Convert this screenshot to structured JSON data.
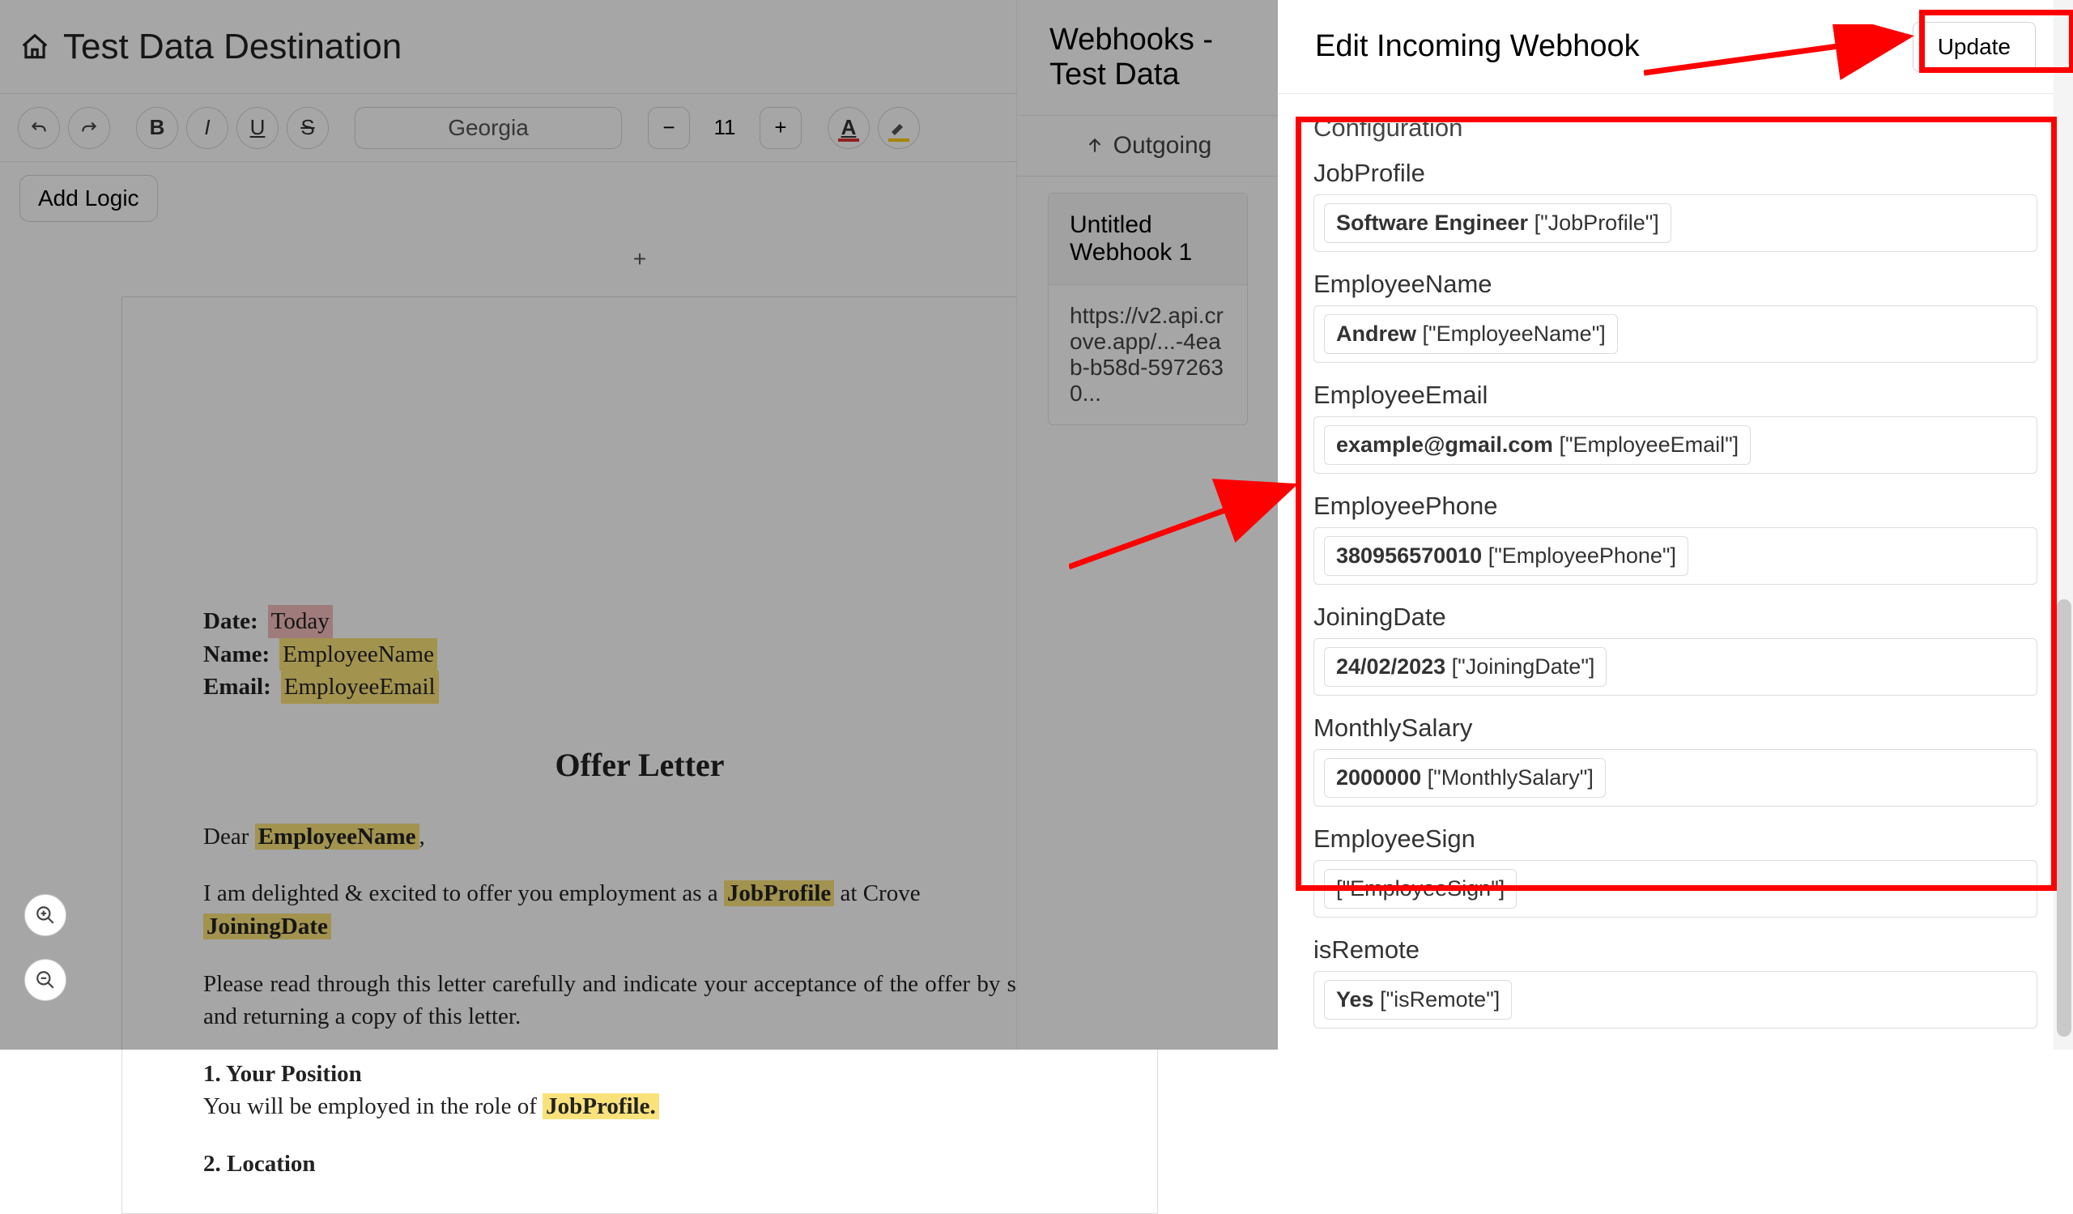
{
  "header": {
    "title": "Test Data Destination"
  },
  "toolbar": {
    "font": "Georgia",
    "fontSize": "11",
    "addLogic": "Add Logic"
  },
  "doc": {
    "date_label": "Date:",
    "date_val": "Today",
    "name_label": "Name:",
    "name_val": "EmployeeName",
    "email_label": "Email:",
    "email_val": "EmployeeEmail",
    "heading": "Offer Letter",
    "greeting_prefix": "Dear ",
    "greeting_name": "EmployeeName",
    "greeting_suffix": ",",
    "p1_a": "I am delighted & excited to offer you employment as a ",
    "p1_job": "JobProfile",
    "p1_b": " at Crove",
    "p1_join": "JoiningDate",
    "p2": "Please read through this letter carefully and indicate your acceptance of the offer by signing and returning a copy of this letter.",
    "s1_title": "1. Your Position",
    "s1_a": "You will be employed in the role of ",
    "s1_job": "JobProfile.",
    "s2_title": "2. Location"
  },
  "midPanel": {
    "title": "Webhooks - Test Data",
    "tabOutgoing": "Outgoing",
    "webhookName": "Untitled Webhook 1",
    "webhookUrl": "https://v2.api.crove.app/...-4eab-b58d-5972630..."
  },
  "rightPanel": {
    "title": "Edit Incoming Webhook",
    "updateBtn": "Update",
    "configTitle": "Configuration",
    "fields": [
      {
        "label": "JobProfile",
        "val": "Software Engineer",
        "path": "[\"JobProfile\"]"
      },
      {
        "label": "EmployeeName",
        "val": "Andrew",
        "path": "[\"EmployeeName\"]"
      },
      {
        "label": "EmployeeEmail",
        "val": "example@gmail.com",
        "path": "[\"EmployeeEmail\"]"
      },
      {
        "label": "EmployeePhone",
        "val": "380956570010",
        "path": "[\"EmployeePhone\"]"
      },
      {
        "label": "JoiningDate",
        "val": "24/02/2023",
        "path": "[\"JoiningDate\"]"
      },
      {
        "label": "MonthlySalary",
        "val": "2000000",
        "path": "[\"MonthlySalary\"]"
      },
      {
        "label": "EmployeeSign",
        "val": "",
        "path": "[\"EmployeeSign\"]"
      },
      {
        "label": "isRemote",
        "val": "Yes",
        "path": "[\"isRemote\"]"
      }
    ]
  }
}
